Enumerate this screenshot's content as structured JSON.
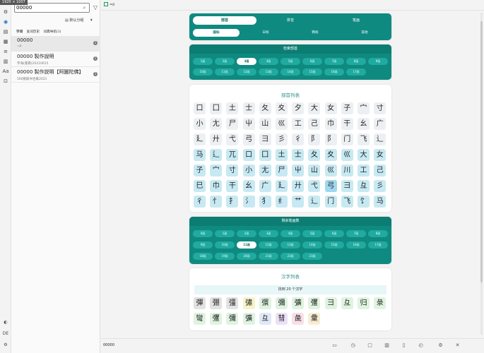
{
  "window": {
    "dims_label": "1920 × 1007"
  },
  "rail": {
    "icons": [
      "gear-icon",
      "search-icon",
      "book-icon",
      "grid-icon",
      "list-icon",
      "chart-icon",
      "font-icon",
      "bookmark-icon"
    ],
    "glyphs": [
      "⚙",
      "◉",
      "▤",
      "▦",
      "≡",
      "▥",
      "Aa",
      "⊡"
    ],
    "bottom_glyphs": [
      "◐",
      "DE",
      "⚙"
    ]
  },
  "search": {
    "value": "00000",
    "sort_label": "默认分组"
  },
  "tabs": [
    {
      "label": "字词"
    },
    {
      "label": "查词历史"
    },
    {
      "label": "词典导航(1)"
    }
  ],
  "results": [
    {
      "title": "00000",
      "subtitle": "=p",
      "badge": "1"
    },
    {
      "title": "00000 製作說明",
      "subtitle": "字海(重典)20210615",
      "badge": "1"
    },
    {
      "title": "00000 製作説明【阿圖陀佛】",
      "subtitle": "500部辭书合集2021",
      "badge": "1"
    }
  ],
  "main_tab": {
    "label": "=p"
  },
  "mode": {
    "top": [
      "部首",
      "拼音",
      "笔画"
    ],
    "top_selected": 0,
    "sub": [
      "国标",
      "日标",
      "韩标",
      "其他"
    ],
    "sub_selected": 0
  },
  "stroke_section": {
    "title": "检索部首",
    "items": [
      "1画",
      "2画",
      "3画",
      "4画",
      "5画",
      "6画",
      "7画",
      "8画",
      "9画",
      "10画",
      "11画",
      "12画",
      "13画",
      "14画",
      "15画",
      "16画",
      "17画"
    ],
    "selected": 2
  },
  "radicals": {
    "title": "部首列表",
    "rows": [
      [
        "口",
        "囗",
        "土",
        "士",
        "夂",
        "夊",
        "夕",
        "大",
        "女",
        "子",
        "宀",
        "寸"
      ],
      [
        "小",
        "尢",
        "尸",
        "屮",
        "山",
        "巛",
        "工",
        "己",
        "巾",
        "干",
        "幺",
        "广"
      ],
      [
        "廴",
        "廾",
        "弋",
        "弓",
        "彐",
        "彡",
        "彳",
        "⻖",
        "阝",
        "门",
        "飞",
        "⻌"
      ],
      [
        "马",
        "⻍",
        "兀",
        "口",
        "囗",
        "土",
        "士",
        "夂",
        "夊",
        "巛",
        "大",
        "女"
      ],
      [
        "子",
        "宀",
        "寸",
        "小",
        "尢",
        "尸",
        "屮",
        "山",
        "巛",
        "川",
        "工",
        "己"
      ],
      [
        "巳",
        "巾",
        "干",
        "幺",
        "广",
        "廴",
        "廾",
        "弋",
        "弓",
        "彐",
        "彑",
        "彡"
      ],
      [
        "彳",
        "忄",
        "扌",
        "氵",
        "犭",
        "纟",
        "艹",
        "辶",
        "门",
        "飞",
        "饣",
        "马"
      ]
    ]
  },
  "remaining": {
    "title": "剩余笔画数",
    "items": [
      "0画",
      "1画",
      "2画",
      "3画",
      "4画",
      "5画",
      "6画",
      "7画",
      "8画",
      "9画",
      "10画",
      "11画",
      "12画",
      "13画",
      "14画",
      "15画",
      "16画",
      "17画",
      "18画",
      "19画",
      "20画",
      "21画",
      "22画",
      "23画"
    ],
    "selected": 11
  },
  "chars": {
    "title": "汉字列表",
    "found": "找到 20 个汉字",
    "items": [
      "彈",
      "弸",
      "彊",
      "彇",
      "彋",
      "彌",
      "彍",
      "彏",
      "彐",
      "彑",
      "归",
      "彔",
      "彎",
      "彏",
      "彌",
      "彍",
      "彑",
      "彗",
      "彘",
      "彙"
    ],
    "colors": [
      "#e2e2e2",
      "#e2e2e2",
      "#e2e2e2",
      "#f7f3c8",
      "#dff3e0",
      "#dff3e0",
      "#dff3e0",
      "#dff3e0",
      "#dff3e0",
      "#dff3e0",
      "#dff3e0",
      "#dff3e0",
      "#dff3e0",
      "#dff3e0",
      "#dff3e0",
      "#dff3e0",
      "#dfe8f7",
      "#ece0f7",
      "#f7dfe8",
      "#f7ecd2"
    ]
  },
  "status": {
    "text": "00000",
    "icons": [
      "monitor-icon",
      "clock-icon",
      "chat-icon",
      "folder-icon",
      "save-icon",
      "history-icon",
      "settings-icon",
      "close-icon"
    ],
    "glyphs": [
      "▭",
      "◷",
      "▢",
      "▥",
      "▯",
      "◴",
      "⚙",
      "✕"
    ]
  }
}
